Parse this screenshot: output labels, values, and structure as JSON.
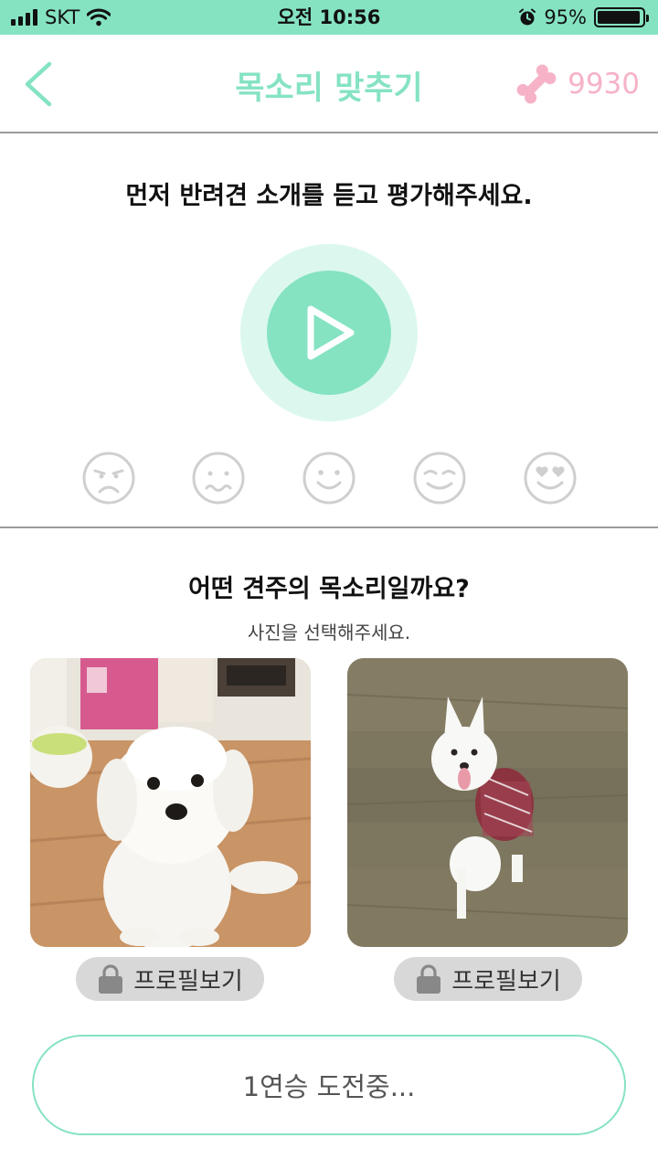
{
  "status_bar": {
    "carrier": "SKT",
    "time": "오전 10:56",
    "battery_percent": "95%",
    "battery_level": 0.95,
    "icons": [
      "signal-icon",
      "wifi-icon",
      "alarm-icon",
      "battery-icon"
    ]
  },
  "header": {
    "title": "목소리 맞추기",
    "points": "9930",
    "icons": [
      "back-chevron-icon",
      "bone-icon"
    ]
  },
  "listen": {
    "instruction": "먼저 반려견 소개를 듣고 평가해주세요.",
    "play_icon": "play-icon"
  },
  "ratings": [
    "sad-face-icon",
    "worried-face-icon",
    "smile-face-icon",
    "content-face-icon",
    "heart-eyes-face-icon"
  ],
  "quiz": {
    "question": "어떤 견주의 목소리일까요?",
    "subtext": "사진을 선택해주세요.",
    "options": [
      {
        "photo": "dog-photo-bichon",
        "profile_label": "프로필보기"
      },
      {
        "photo": "dog-photo-spitz",
        "profile_label": "프로필보기"
      }
    ]
  },
  "challenge": {
    "label": "1연승 도전중..."
  },
  "colors": {
    "accent": "#85e3c2",
    "accent_light": "#dcf8ee",
    "points": "#f6b2c6",
    "divider": "#9a9a9a",
    "face": "#cfcfcf"
  }
}
